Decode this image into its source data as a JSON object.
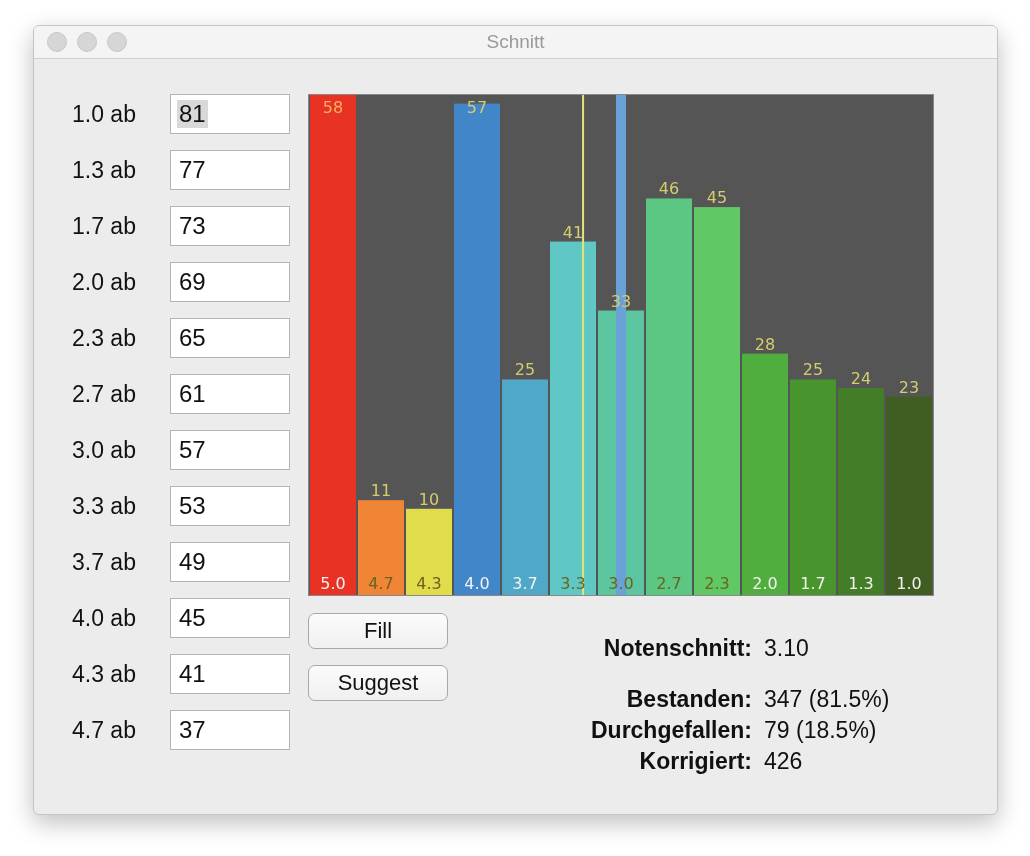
{
  "window": {
    "title": "Schnitt"
  },
  "thresholds": [
    {
      "label": "1.0 ab",
      "value": "81",
      "selected": true
    },
    {
      "label": "1.3 ab",
      "value": "77",
      "selected": false
    },
    {
      "label": "1.7 ab",
      "value": "73",
      "selected": false
    },
    {
      "label": "2.0 ab",
      "value": "69",
      "selected": false
    },
    {
      "label": "2.3 ab",
      "value": "65",
      "selected": false
    },
    {
      "label": "2.7 ab",
      "value": "61",
      "selected": false
    },
    {
      "label": "3.0 ab",
      "value": "57",
      "selected": false
    },
    {
      "label": "3.3 ab",
      "value": "53",
      "selected": false
    },
    {
      "label": "3.7 ab",
      "value": "49",
      "selected": false
    },
    {
      "label": "4.0 ab",
      "value": "45",
      "selected": false
    },
    {
      "label": "4.3 ab",
      "value": "41",
      "selected": false
    },
    {
      "label": "4.7 ab",
      "value": "37",
      "selected": false
    }
  ],
  "histogram": {
    "chart_data": {
      "type": "bar",
      "categories": [
        "5.0",
        "4.7",
        "4.3",
        "4.0",
        "3.7",
        "3.3",
        "3.0",
        "2.7",
        "2.3",
        "2.0",
        "1.7",
        "1.3",
        "1.0"
      ],
      "series": [
        {
          "color": "#e83324",
          "values": [
            58,
            null,
            null,
            null,
            null,
            null,
            null,
            null,
            null,
            null,
            null,
            null,
            null
          ]
        },
        {
          "color": "#ef8535",
          "values": [
            null,
            11,
            null,
            null,
            null,
            null,
            null,
            null,
            null,
            null,
            null,
            null,
            null
          ]
        },
        {
          "color": "#e0dc4c",
          "values": [
            null,
            null,
            10,
            null,
            null,
            null,
            null,
            null,
            null,
            null,
            null,
            null,
            null
          ]
        },
        {
          "color": "#4186c9",
          "values": [
            null,
            null,
            null,
            57,
            null,
            null,
            null,
            null,
            null,
            null,
            null,
            null,
            null
          ]
        },
        {
          "color": "#4fa8c8",
          "values": [
            null,
            null,
            null,
            null,
            25,
            null,
            null,
            null,
            null,
            null,
            null,
            null,
            null
          ]
        },
        {
          "color": "#5fc8c4",
          "values": [
            null,
            null,
            null,
            null,
            null,
            41,
            null,
            null,
            null,
            null,
            null,
            null,
            null
          ]
        },
        {
          "color": "#5cc6a0",
          "values": [
            null,
            null,
            null,
            null,
            null,
            null,
            33,
            null,
            null,
            null,
            null,
            null,
            null
          ]
        },
        {
          "color": "#5cc683",
          "values": [
            null,
            null,
            null,
            null,
            null,
            null,
            null,
            46,
            null,
            null,
            null,
            null,
            null
          ]
        },
        {
          "color": "#60c865",
          "values": [
            null,
            null,
            null,
            null,
            null,
            null,
            null,
            null,
            45,
            null,
            null,
            null,
            null
          ]
        },
        {
          "color": "#50ae3e",
          "values": [
            null,
            null,
            null,
            null,
            null,
            null,
            null,
            null,
            null,
            28,
            null,
            null,
            null
          ]
        },
        {
          "color": "#48952e",
          "values": [
            null,
            null,
            null,
            null,
            null,
            null,
            null,
            null,
            null,
            null,
            25,
            null,
            null
          ]
        },
        {
          "color": "#437d27",
          "values": [
            null,
            null,
            null,
            null,
            null,
            null,
            null,
            null,
            null,
            null,
            null,
            24,
            null
          ]
        },
        {
          "color": "#405e22",
          "values": [
            null,
            null,
            null,
            null,
            null,
            null,
            null,
            null,
            null,
            null,
            null,
            null,
            23
          ]
        }
      ],
      "ylim": [
        0,
        58
      ],
      "data_labels": true
    }
  },
  "buttons": [
    "Fill",
    "Suggest"
  ],
  "average": {
    "label": "Notenschnitt:",
    "value": "3.10"
  },
  "stats": [
    {
      "label": "Bestanden:",
      "value": "347 (81.5%)"
    },
    {
      "label": "Durchgefallen:",
      "value": "79 (18.5%)"
    },
    {
      "label": "Korrigiert:",
      "value": "426"
    }
  ]
}
